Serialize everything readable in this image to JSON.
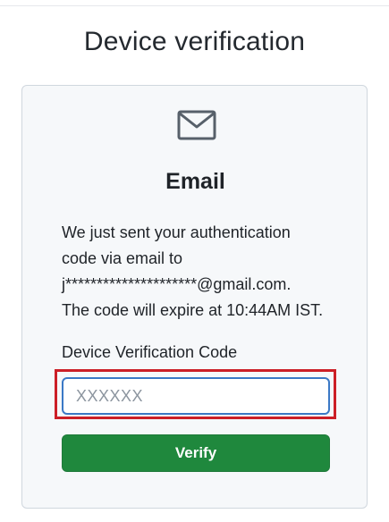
{
  "page": {
    "title": "Device verification"
  },
  "card": {
    "icon": "mail-icon",
    "heading": "Email",
    "description_lines": [
      "We just sent your authentication",
      "code via email to",
      "j*********************@gmail.com.",
      "The code will expire at 10:44AM IST."
    ],
    "field_label": "Device Verification Code",
    "code_input": {
      "value": "",
      "placeholder": "XXXXXX"
    },
    "verify_label": "Verify"
  },
  "colors": {
    "primary_button": "#1f883d",
    "input_focus_border": "#3b79c6",
    "highlight_border": "#cc1f27",
    "card_background": "#f6f8fa"
  }
}
